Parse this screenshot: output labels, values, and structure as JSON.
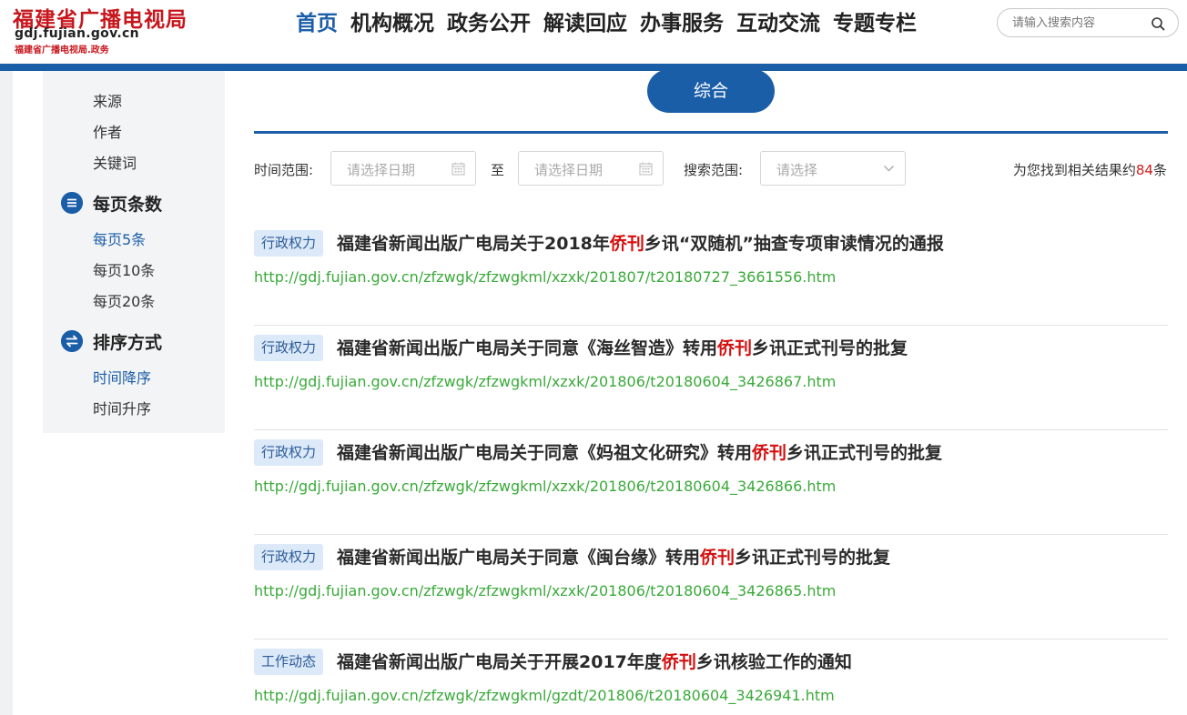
{
  "header": {
    "logo_cn": "福建省广播电视局",
    "logo_domain": "gdj.fujian.gov.cn",
    "logo_sub": "福建省广播电视局.政务",
    "nav": [
      "首页",
      "机构概况",
      "政务公开",
      "解读回应",
      "办事服务",
      "互动交流",
      "专题专栏"
    ],
    "active_nav": 0,
    "search_placeholder": "请输入搜索内容"
  },
  "sidebar": {
    "top_items": [
      "来源",
      "作者",
      "关键词"
    ],
    "per_page": {
      "heading": "每页条数",
      "options": [
        "每页5条",
        "每页10条",
        "每页20条"
      ],
      "active": 0
    },
    "sort": {
      "heading": "排序方式",
      "options": [
        "时间降序",
        "时间升序"
      ],
      "active": 0
    }
  },
  "main": {
    "tab_label": "综合",
    "filters": {
      "time_label": "时间范围:",
      "date_placeholder_start": "请选择日期",
      "to_label": "至",
      "date_placeholder_end": "请选择日期",
      "scope_label": "搜索范围:",
      "scope_placeholder": "请选择"
    },
    "count": {
      "prefix": "为您找到相关结果约",
      "number": "84",
      "suffix": "条"
    },
    "results": [
      {
        "tag": "行政权力",
        "title_pre": "福建省新闻出版广电局关于2018年",
        "highlight": "侨刊",
        "title_post": "乡讯“双随机”抽查专项审读情况的通报",
        "url": "http://gdj.fujian.gov.cn/zfzwgk/zfzwgkml/xzxk/201807/t20180727_3661556.htm"
      },
      {
        "tag": "行政权力",
        "title_pre": "福建省新闻出版广电局关于同意《海丝智造》转用",
        "highlight": "侨刊",
        "title_post": "乡讯正式刊号的批复",
        "url": "http://gdj.fujian.gov.cn/zfzwgk/zfzwgkml/xzxk/201806/t20180604_3426867.htm"
      },
      {
        "tag": "行政权力",
        "title_pre": "福建省新闻出版广电局关于同意《妈祖文化研究》转用",
        "highlight": "侨刊",
        "title_post": "乡讯正式刊号的批复",
        "url": "http://gdj.fujian.gov.cn/zfzwgk/zfzwgkml/xzxk/201806/t20180604_3426866.htm"
      },
      {
        "tag": "行政权力",
        "title_pre": "福建省新闻出版广电局关于同意《闽台缘》转用",
        "highlight": "侨刊",
        "title_post": "乡讯正式刊号的批复",
        "url": "http://gdj.fujian.gov.cn/zfzwgk/zfzwgkml/xzxk/201806/t20180604_3426865.htm"
      },
      {
        "tag": "工作动态",
        "title_pre": "福建省新闻出版广电局关于开展2017年度",
        "highlight": "侨刊",
        "title_post": "乡讯核验工作的通知",
        "url": "http://gdj.fujian.gov.cn/zfzwgk/zfzwgkml/gzdt/201806/t20180604_3426941.htm"
      }
    ]
  },
  "colors": {
    "brand_blue": "#1b5ea8",
    "highlight_red": "#d40f0f",
    "url_green": "#3aaa3a",
    "logo_red": "#c8161d"
  }
}
